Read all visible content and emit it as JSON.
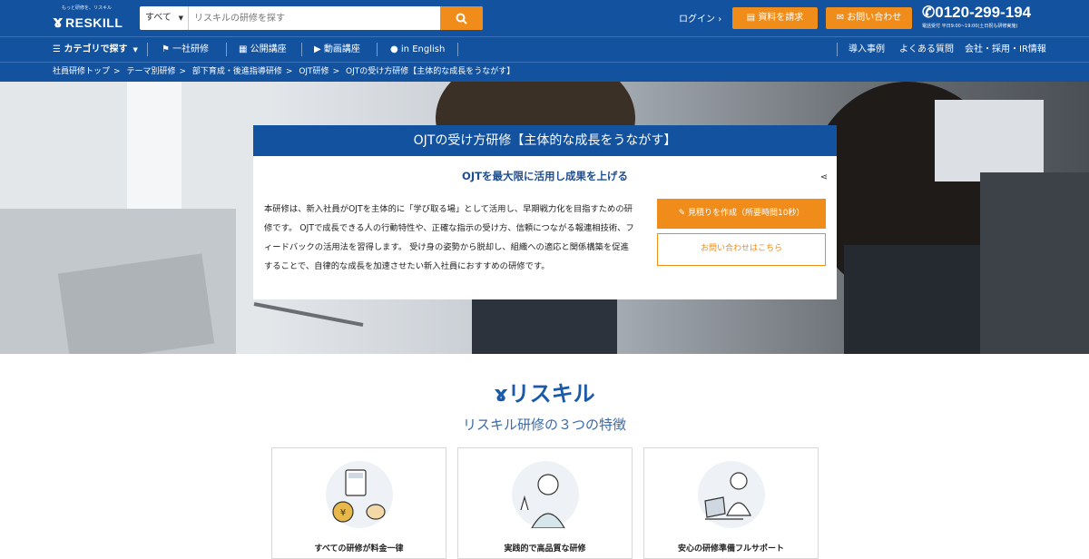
{
  "header": {
    "logo_tagline": "もっと研修を、リスキル",
    "logo_name": "RESKILL",
    "search_category": "すべて",
    "search_placeholder": "リスキルの研修を探す",
    "login": "ログイン",
    "request_docs": "資料を請求",
    "contact": "お問い合わせ",
    "phone": "0120-299-194",
    "phone_hours": "電話受付 平日9:00~19:00(土日祝も研修実施)"
  },
  "nav": {
    "category": "カテゴリで探す",
    "items_left": [
      "一社研修",
      "公開講座",
      "動画講座",
      "in English"
    ],
    "items_right": [
      "導入事例",
      "よくある質問",
      "会社・採用・IR情報"
    ]
  },
  "breadcrumb": [
    "社員研修トップ",
    "テーマ別研修",
    "部下育成・後進指導研修",
    "OJT研修",
    "OJTの受け方研修【主体的な成長をうながす】"
  ],
  "hero": {
    "title": "OJTの受け方研修【主体的な成長をうながす】",
    "subtitle": "OJTを最大限に活用し成果を上げる",
    "description": "本研修は、新入社員がOJTを主体的に「学び取る場」として活用し、早期戦力化を目指すための研修です。 OJTで成長できる人の行動特性や、正確な指示の受け方、信頼につながる報連相技術、フィードバックの活用法を習得します。 受け身の姿勢から脱却し、組織への適応と関係構築を促進することで、自律的な成長を加速させたい新入社員におすすめの研修です。",
    "estimate_button": "見積りを作成（所要時間10秒）",
    "inquiry_button": "お問い合わせはこちら"
  },
  "features": {
    "brand": "リスキル",
    "heading": "リスキル研修の３つの特徴",
    "cards": [
      "すべての研修が料金一律",
      "実践的で高品質な研修",
      "安心の研修準備フルサポート"
    ]
  },
  "colors": {
    "primary": "#13529e",
    "accent": "#f08c19"
  }
}
